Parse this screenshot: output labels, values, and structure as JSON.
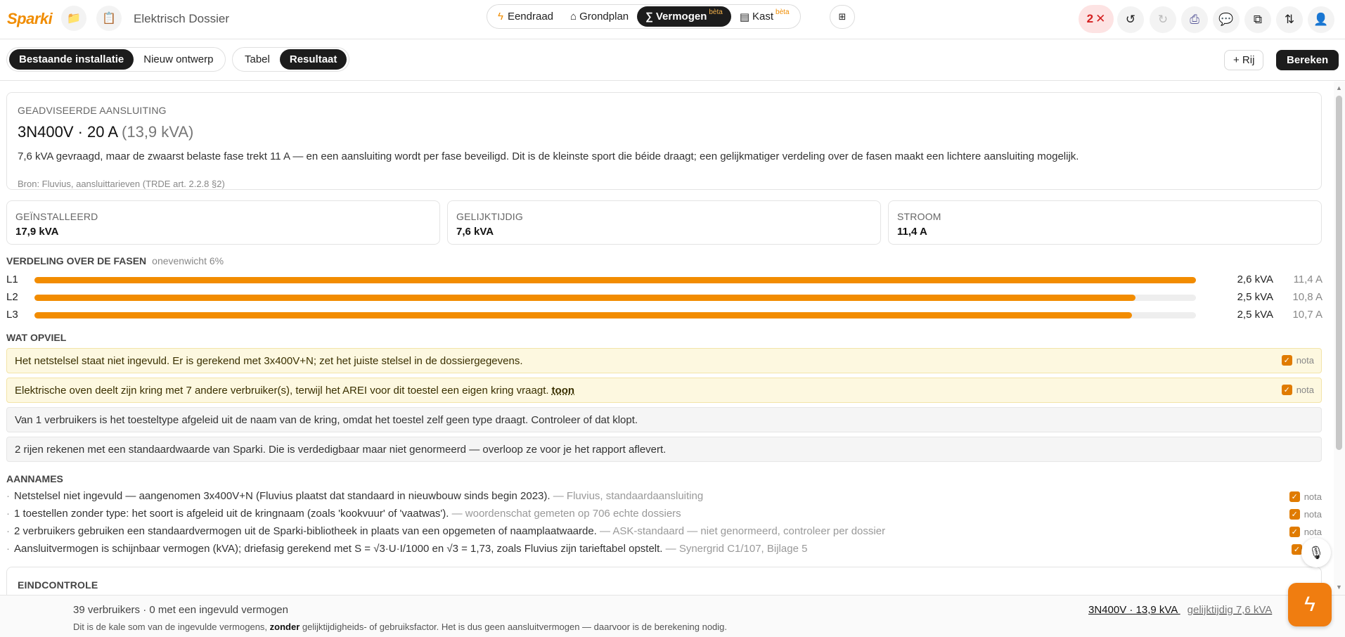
{
  "header": {
    "logo": "Sparki",
    "doc_title": "Elektrisch Dossier",
    "modes": [
      {
        "icon": "lightning-icon",
        "label": "Eendraad",
        "badge": ""
      },
      {
        "icon": "house-icon",
        "label": "Grondplan",
        "badge": ""
      },
      {
        "icon": "sigma-icon",
        "label": "Vermogen",
        "badge": "bèta"
      },
      {
        "icon": "cabinet-icon",
        "label": "Kast",
        "badge": "bèta"
      }
    ],
    "active_mode": "Vermogen",
    "error_count": "2",
    "accent_color": "#f08c00"
  },
  "toolbar": {
    "scope_tabs": [
      "Bestaande installatie",
      "Nieuw ontwerp"
    ],
    "view_tabs": [
      "Tabel",
      "Resultaat"
    ],
    "add_row_label": "+ Rij",
    "calculate_label": "Bereken"
  },
  "advice": {
    "heading": "GEADVISEERDE AANSLUITING",
    "value_main": "3N400V · 20 A",
    "value_muted": "(13,9 kVA)",
    "description": "7,6 kVA gevraagd, maar de zwaarst belaste fase trekt 11 A — en een aansluiting wordt per fase beveiligd. Dit is de kleinste sport die béide draagt; een gelijkmatiger verdeling over de fasen maakt een lichtere aansluiting mogelijk.",
    "source": "Bron: Fluvius, aansluittarieven (TRDE art. 2.2.8 §2)"
  },
  "stats": [
    {
      "label": "GEÏNSTALLEERD",
      "value": "17,9 kVA"
    },
    {
      "label": "GELIJKTIJDIG",
      "value": "7,6 kVA"
    },
    {
      "label": "STROOM",
      "value": "11,4 A"
    }
  ],
  "phases": {
    "heading": "VERDELING OVER DE FASEN",
    "imbalance": "onevenwicht 6%",
    "rows": [
      {
        "label": "L1",
        "kva": "2,6 kVA",
        "amp": "11,4 A",
        "level": 1.0
      },
      {
        "label": "L2",
        "kva": "2,5 kVA",
        "amp": "10,8 A",
        "level": 0.948
      },
      {
        "label": "L3",
        "kva": "2,5 kVA",
        "amp": "10,7 A",
        "level": 0.945
      }
    ]
  },
  "findings": {
    "heading": "WAT OPVIEL",
    "items": [
      {
        "text": "Het netstelsel staat niet ingevuld. Er is gerekend met 3x400V+N; zet het juiste stelsel in de dossiergegevens.",
        "link": "",
        "nota": "nota",
        "type": "warn"
      },
      {
        "text": "Elektrische oven deelt zijn kring met 7 andere verbruiker(s), terwijl het AREI voor dit toestel een eigen kring vraagt.",
        "link": "toon",
        "nota": "nota",
        "type": "warn"
      },
      {
        "text": "Van 1 verbruikers is het toesteltype afgeleid uit de naam van de kring, omdat het toestel zelf geen type draagt. Controleer of dat klopt.",
        "link": "",
        "nota": "",
        "type": "info"
      },
      {
        "text": "2 rijen rekenen met een standaardwaarde van Sparki. Die is verdedigbaar maar niet genormeerd — overloop ze voor je het rapport aflevert.",
        "link": "",
        "nota": "",
        "type": "info"
      }
    ]
  },
  "assumptions": {
    "heading": "AANNAMES",
    "items": [
      {
        "text": "Netstelsel niet ingevuld — aangenomen 3x400V+N (Fluvius plaatst dat standaard in nieuwbouw sinds begin 2023).",
        "source": "— Fluvius, standaardaansluiting",
        "nota": "nota"
      },
      {
        "text": "1 toestellen zonder type: het soort is afgeleid uit de kringnaam (zoals 'kookvuur' of 'vaatwas').",
        "source": "— woordenschat gemeten op 706 echte dossiers",
        "nota": "nota"
      },
      {
        "text": "2 verbruikers gebruiken een standaardvermogen uit de Sparki-bibliotheek in plaats van een opgemeten of naamplaatwaarde.",
        "source": "— ASK-standaard — niet genormeerd, controleer per dossier",
        "nota": "nota"
      },
      {
        "text": "Aansluitvermogen is schijnbaar vermogen (kVA); driefasig gerekend met S = √3·U·I/1000 en √3 = 1,73, zoals Fluvius zijn tarieftabel opstelt.",
        "source": "— Synergrid C1/107, Bijlage 5",
        "nota": ""
      }
    ]
  },
  "final_check": {
    "heading": "EINDCONTROLE"
  },
  "footer": {
    "line1": "39 verbruikers · 0 met een ingevuld vermogen",
    "line2_a": "Dit is de kale som van de ingevulde vermogens, ",
    "line2_bold": "zonder",
    "line2_b": " gelijktijdigheids- of gebruiksfactor. Het is dus geen aansluitvermogen — daarvoor is de berekening nodig.",
    "summary_main": "3N400V · 13,9 kVA",
    "summary_muted": "gelijktijdig 7,6 kVA"
  }
}
